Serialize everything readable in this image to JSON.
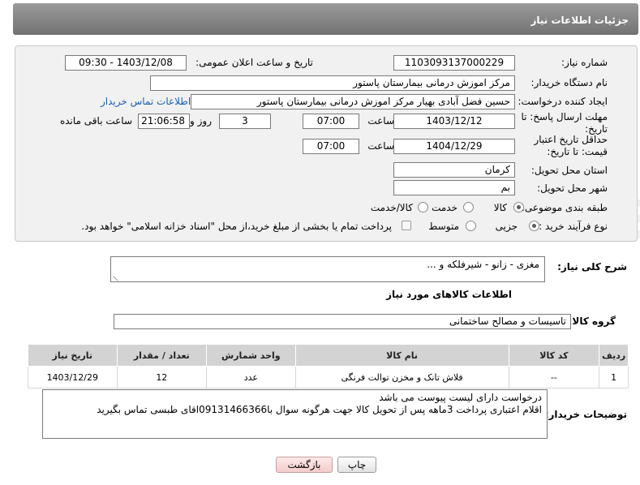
{
  "header": {
    "title": "جزئیات اطلاعات نیاز"
  },
  "labels": {
    "need_number": "شماره نیاز:",
    "announce_datetime": "تاریخ و ساعت اعلان عمومی:",
    "buyer_org": "نام دستگاه خریدار:",
    "requester": "ایجاد کننده درخواست:",
    "contact_link": "اطلاعات تماس خریدار",
    "reply_deadline": "مهلت ارسال پاسخ: تا تاریخ:",
    "time": "ساعت",
    "day_and": "روز و",
    "time_remaining": "ساعت باقی مانده",
    "price_validity": "حداقل تاریخ اعتبار قیمت: تا تاریخ:",
    "province": "استان محل تحویل:",
    "city": "شهر محل تحویل:",
    "category": "طبقه بندی موضوعی:",
    "process_type": "نوع فرآیند خرید :",
    "general_desc": "شرح کلی نیاز:",
    "goods_info": "اطلاعات کالاهای مورد نیاز",
    "goods_group": "گروه کالا:",
    "buyer_notes": "توضیحات خریدار:"
  },
  "values": {
    "need_number": "1103093137000229",
    "announce_datetime": "1403/12/08 - 09:30",
    "buyer_org": "مرکز اموزش درمانی بیمارستان پاستور",
    "requester": "حسین فضل آبادی بهیار مرکز اموزش درمانی بیمارستان پاستور",
    "reply_date": "1403/12/12",
    "reply_time": "07:00",
    "days_remaining": "3",
    "time_remaining": "21:06:58",
    "validity_date": "1404/12/29",
    "validity_time": "07:00",
    "province": "کرمان",
    "city": "بم",
    "general_desc": "مغزی - زانو - شیرفلکه و ...",
    "goods_group": "تاسیسات و مصالح ساختمانی",
    "buyer_notes_line1": "درخواست دارای لیست پیوست می باشد",
    "buyer_notes_line2": "اقلام اعتباری پرداخت 3ماهه پس از تحویل کالا جهت هرگونه سوال با09131466366اقای طبسی تماس بگیرید"
  },
  "category_options": {
    "goods": "کالا",
    "service": "خدمت",
    "goods_service": "کالا/خدمت",
    "selected": "کالا"
  },
  "process_options": {
    "partial": "جزیی",
    "medium": "متوسط",
    "treasury_note": "پرداخت تمام یا بخشی از مبلغ خرید،از محل \"اسناد خزانه اسلامی\" خواهد بود.",
    "selected": "جزیی"
  },
  "table": {
    "headers": {
      "row": "ردیف",
      "code": "کد کالا",
      "name": "نام کالا",
      "unit": "واحد شمارش",
      "qty": "تعداد / مقدار",
      "date": "تاریخ نیاز"
    },
    "rows": [
      {
        "row": "1",
        "code": "--",
        "name": "فلاش تانک و مخزن توالت فرنگی",
        "unit": "عدد",
        "qty": "12",
        "date": "1403/12/29"
      }
    ]
  },
  "buttons": {
    "print": "چاپ",
    "back": "بازگشت"
  },
  "watermark": "AriaTender.neT"
}
